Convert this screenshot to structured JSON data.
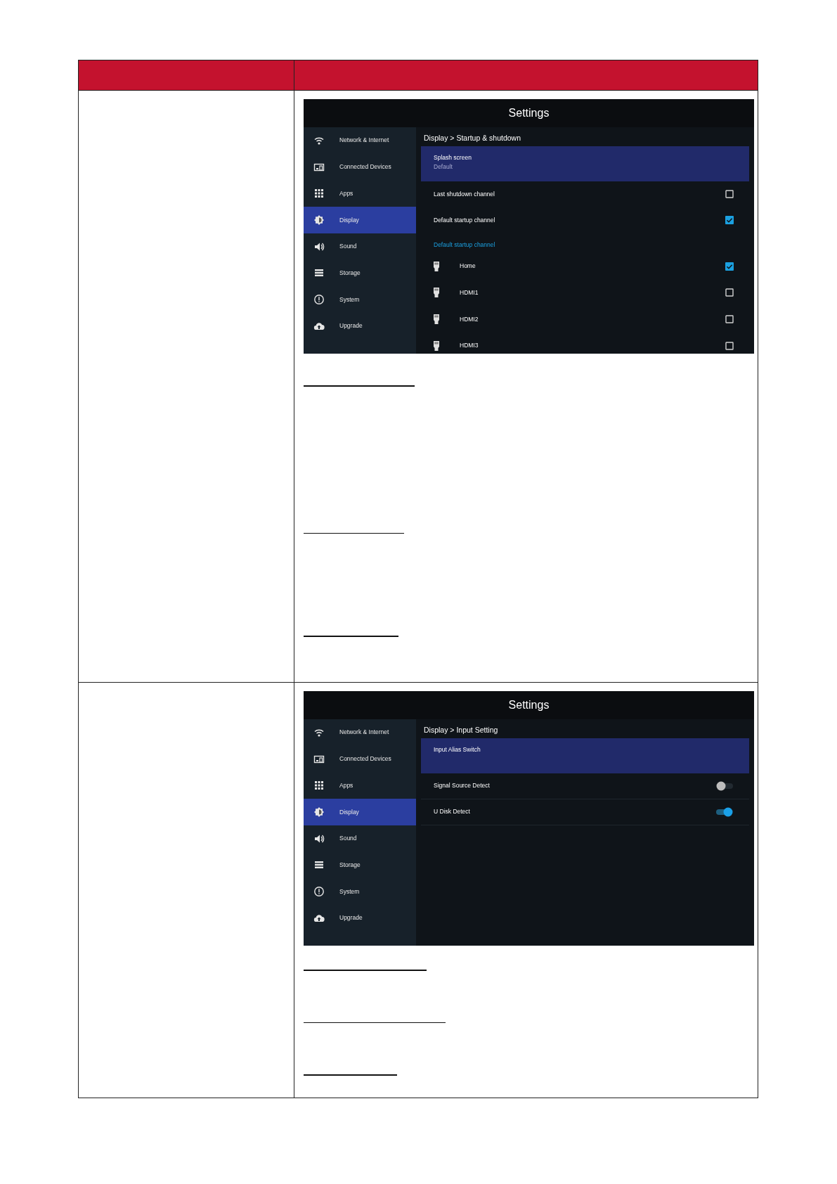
{
  "rows": [
    {
      "screen": {
        "title": "Settings",
        "sidebar": [
          {
            "label": "Network & Internet",
            "selected": false
          },
          {
            "label": "Connected Devices",
            "selected": false
          },
          {
            "label": "Apps",
            "selected": false
          },
          {
            "label": "Display",
            "selected": true
          },
          {
            "label": "Sound",
            "selected": false
          },
          {
            "label": "Storage",
            "selected": false
          },
          {
            "label": "System",
            "selected": false
          },
          {
            "label": "Upgrade",
            "selected": false
          }
        ],
        "breadcrumb": "Display > Startup & shutdown",
        "items": [
          {
            "kind": "entry",
            "label": "Splash screen",
            "subtitle": "Default",
            "selected": true
          },
          {
            "kind": "checkbox",
            "label": "Last shutdown channel",
            "checked": false
          },
          {
            "kind": "checkbox",
            "label": "Default startup channel",
            "checked": true
          },
          {
            "kind": "header",
            "label": "Default startup channel"
          },
          {
            "kind": "source",
            "label": "Home",
            "checked": true
          },
          {
            "kind": "source",
            "label": "HDMI1",
            "checked": false
          },
          {
            "kind": "source",
            "label": "HDMI2",
            "checked": false
          },
          {
            "kind": "source",
            "label": "HDMI3",
            "checked": false
          }
        ]
      }
    },
    {
      "screen": {
        "title": "Settings",
        "sidebar": [
          {
            "label": "Network & Internet",
            "selected": false
          },
          {
            "label": "Connected Devices",
            "selected": false
          },
          {
            "label": "Apps",
            "selected": false
          },
          {
            "label": "Display",
            "selected": true
          },
          {
            "label": "Sound",
            "selected": false
          },
          {
            "label": "Storage",
            "selected": false
          },
          {
            "label": "System",
            "selected": false
          },
          {
            "label": "Upgrade",
            "selected": false
          }
        ],
        "breadcrumb": "Display > Input Setting",
        "items": [
          {
            "kind": "entry",
            "label": "Input Alias Switch",
            "selected": true
          },
          {
            "kind": "toggle",
            "label": "Signal Source Detect",
            "on": false
          },
          {
            "kind": "toggle",
            "label": "U Disk Detect",
            "on": true
          }
        ]
      }
    }
  ]
}
